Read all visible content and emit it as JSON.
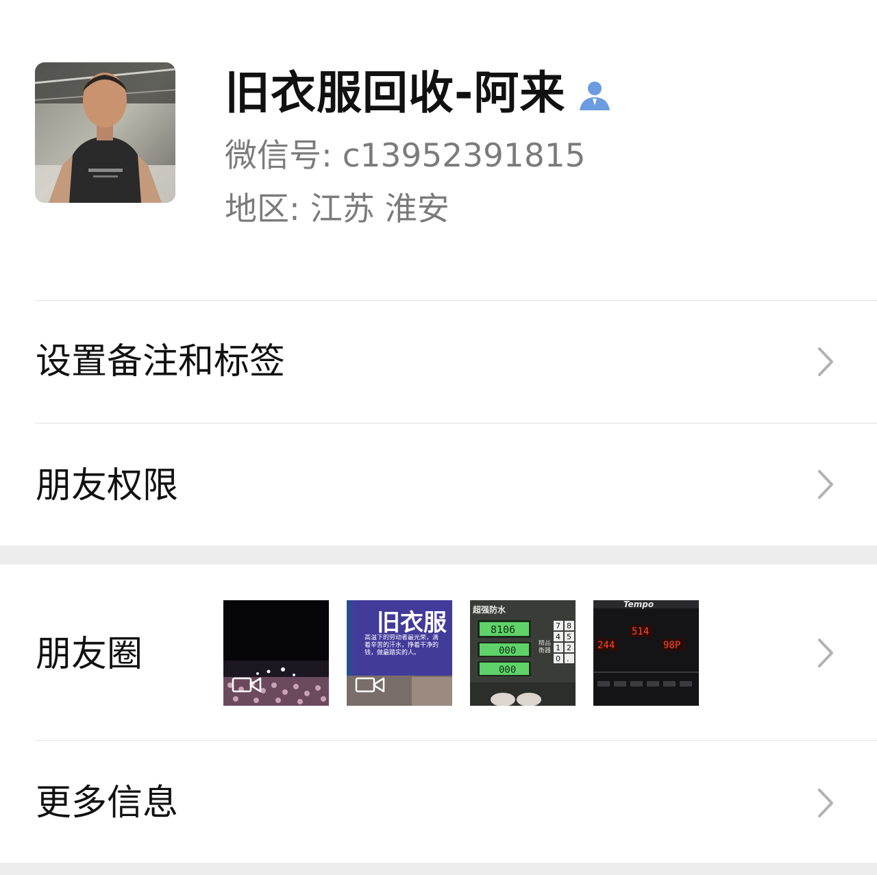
{
  "profile": {
    "name": "旧衣服回收-阿来",
    "wechat_id": "微信号: c13952391815",
    "region": "地区: 江苏  淮安",
    "avatar": "avatar-photo",
    "contact_icon": "person-icon"
  },
  "menu": {
    "remark_tags": "设置备注和标签",
    "friend_permissions": "朋友权限",
    "moments": "朋友圈",
    "more_info": "更多信息"
  },
  "moments_thumbnails": [
    {
      "kind": "video",
      "icon": "video-icon"
    },
    {
      "kind": "video",
      "icon": "video-icon",
      "sign_text": "旧衣服",
      "caption": "高温下的劳动者最光荣，滴着辛苦的汗水，挣着干净的钱，做最踏实的人。"
    },
    {
      "kind": "image",
      "header": "超强防水",
      "readings": [
        "8106",
        "000",
        "000"
      ],
      "keypad": [
        "7",
        "8",
        "4",
        "5",
        "1",
        "2",
        "0",
        "."
      ],
      "side_text": "精品衡器"
    },
    {
      "kind": "image",
      "brand": "Tempo",
      "readings": [
        "514",
        "244",
        "98P"
      ]
    }
  ],
  "colors": {
    "accent_icon": "#6b9be0",
    "secondary_text": "#7b7b7b",
    "section_gap": "#ededed",
    "divider": "#e3e3e3",
    "chevron": "#b2b2b2"
  }
}
